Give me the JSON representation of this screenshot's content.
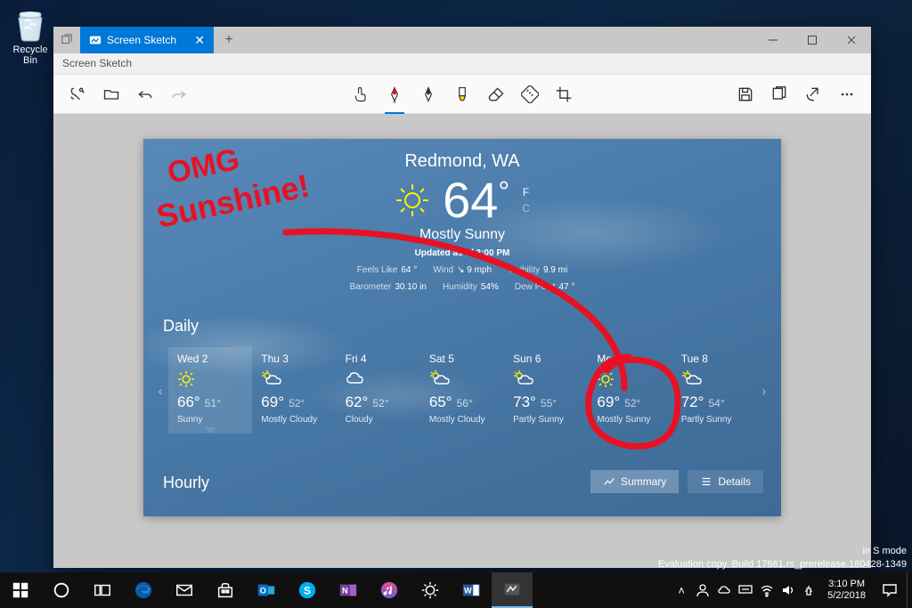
{
  "desktop": {
    "recycle_bin": "Recycle Bin"
  },
  "window": {
    "tab_title": "Screen Sketch",
    "menu_title": "Screen Sketch",
    "controls": {
      "min": "—",
      "max": "▢",
      "close": "✕"
    }
  },
  "tools": {
    "snip": "snip",
    "open": "open",
    "undo": "undo",
    "redo": "redo",
    "touch": "touch-writing",
    "pen": "pen",
    "pencil": "pencil",
    "highlighter": "highlighter",
    "eraser": "eraser",
    "ruler": "ruler",
    "crop": "crop",
    "save": "save",
    "copy": "copy",
    "share": "share",
    "more": "more"
  },
  "weather": {
    "location": "Redmond, WA",
    "temp": "64",
    "unit_f": "F",
    "unit_c": "C",
    "condition": "Mostly Sunny",
    "updated": "Updated as of 3:00 PM",
    "stats": [
      {
        "label": "Feels Like",
        "value": "64 °"
      },
      {
        "label": "Wind",
        "value": "↘ 9 mph"
      },
      {
        "label": "Visibility",
        "value": "9.9 mi"
      },
      {
        "label": "Barometer",
        "value": "30.10 in"
      },
      {
        "label": "Humidity",
        "value": "54%"
      },
      {
        "label": "Dew Point",
        "value": "47 °"
      }
    ],
    "daily_header": "Daily",
    "days": [
      {
        "label": "Wed 2",
        "hi": "66°",
        "lo": "51°",
        "cond": "Sunny",
        "icon": "sun",
        "sel": true
      },
      {
        "label": "Thu 3",
        "hi": "69°",
        "lo": "52°",
        "cond": "Mostly Cloudy",
        "icon": "pcloud"
      },
      {
        "label": "Fri 4",
        "hi": "62°",
        "lo": "52°",
        "cond": "Cloudy",
        "icon": "cloud"
      },
      {
        "label": "Sat 5",
        "hi": "65°",
        "lo": "56°",
        "cond": "Mostly Cloudy",
        "icon": "pcloud"
      },
      {
        "label": "Sun 6",
        "hi": "73°",
        "lo": "55°",
        "cond": "Partly Sunny",
        "icon": "pcloud"
      },
      {
        "label": "Mon 7",
        "hi": "69°",
        "lo": "52°",
        "cond": "Mostly Sunny",
        "icon": "sun"
      },
      {
        "label": "Tue 8",
        "hi": "72°",
        "lo": "54°",
        "cond": "Partly Sunny",
        "icon": "pcloud"
      }
    ],
    "hourly_header": "Hourly",
    "buttons": {
      "summary": "Summary",
      "details": "Details"
    }
  },
  "ink": {
    "text": "OMG Sunshine!",
    "color": "#e81123"
  },
  "taskbar": {
    "clock_time": "3:10 PM",
    "clock_date": "5/2/2018"
  },
  "watermark": {
    "line1": "in S mode",
    "line2": "Evaluation copy. Build 17661.rs_prerelease.180428-1349"
  }
}
